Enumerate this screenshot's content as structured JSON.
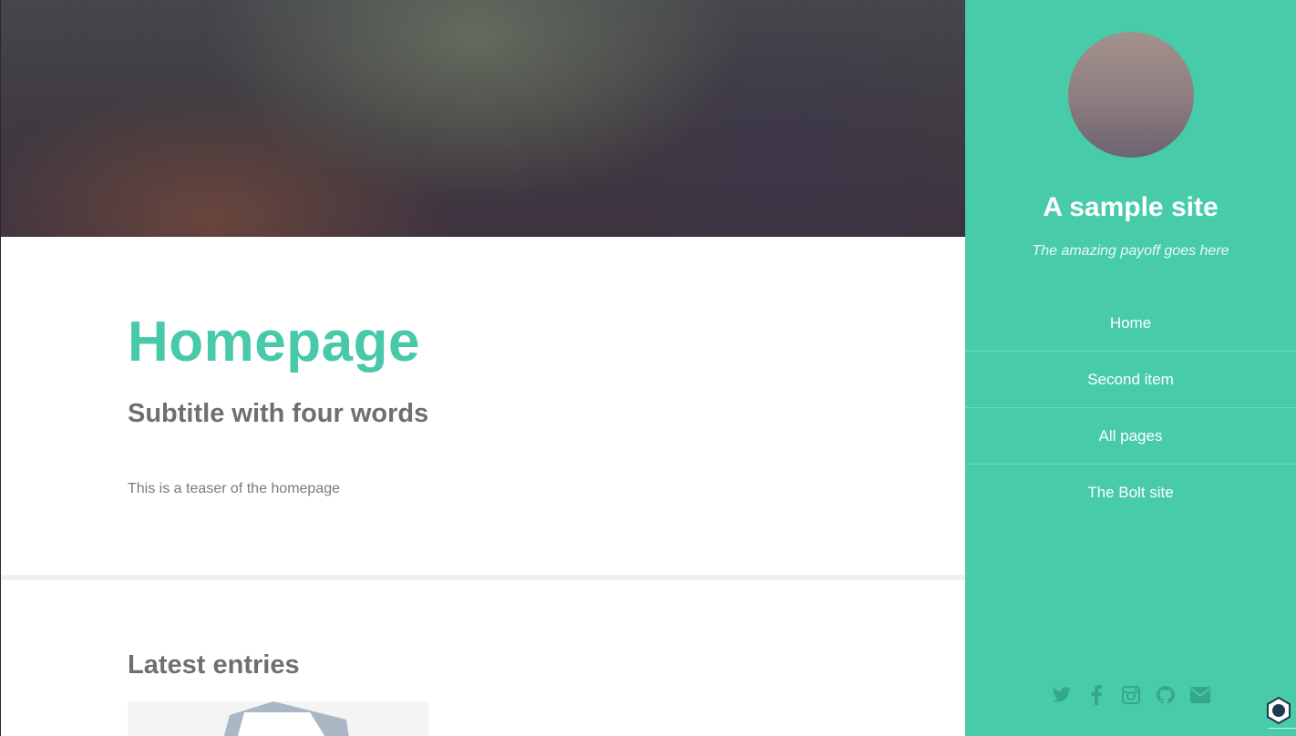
{
  "main": {
    "title": "Homepage",
    "subtitle": "Subtitle with four words",
    "teaser": "This is a teaser of the homepage",
    "latest_heading": "Latest entries"
  },
  "sidebar": {
    "site_title": "A sample site",
    "payoff": "The amazing payoff goes here",
    "nav": [
      {
        "label": "Home"
      },
      {
        "label": "Second item"
      },
      {
        "label": "All pages"
      },
      {
        "label": "The Bolt site"
      }
    ],
    "social_icons": [
      "twitter-icon",
      "facebook-icon",
      "instagram-icon",
      "github-icon",
      "email-icon"
    ]
  },
  "colors": {
    "accent": "#48cba9",
    "title_green": "#48c9a9",
    "heading_gray": "#716e70",
    "text_gray": "#7d787c"
  }
}
